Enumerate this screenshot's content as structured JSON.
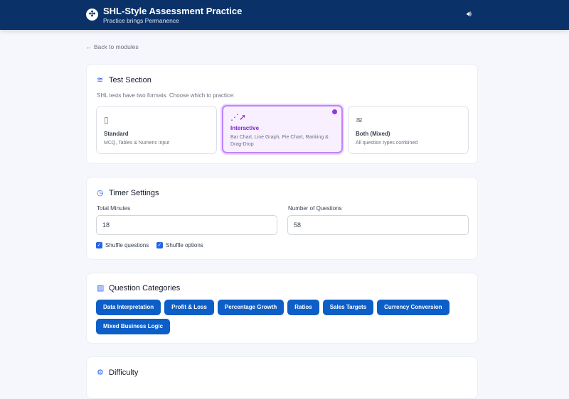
{
  "header": {
    "title": "SHL-Style Assessment Practice",
    "subtitle": "Practice brings Permanence"
  },
  "back_link": "Back to modules",
  "test_section": {
    "title": "Test Section",
    "description": "SHL tests have two formats. Choose which to practice:",
    "options": [
      {
        "name": "Standard",
        "desc": "MCQ, Tables & Numeric input"
      },
      {
        "name": "Interactive",
        "desc": "Bar Chart, Line Graph, Pie Chart, Ranking & Drag-Drop",
        "selected": true
      },
      {
        "name": "Both (Mixed)",
        "desc": "All question types combined"
      }
    ]
  },
  "timer": {
    "title": "Timer Settings",
    "total_minutes_label": "Total Minutes",
    "total_minutes": "18",
    "num_questions_label": "Number of Questions",
    "num_questions": "58",
    "shuffle_questions": "Shuffle questions",
    "shuffle_options": "Shuffle options"
  },
  "categories": {
    "title": "Question Categories",
    "items": [
      "Data Interpretation",
      "Profit & Loss",
      "Percentage Growth",
      "Ratios",
      "Sales Targets",
      "Currency Conversion",
      "Mixed Business Logic"
    ]
  },
  "difficulty": {
    "title": "Difficulty"
  },
  "colors": {
    "header": "#0b3268",
    "accent": "#0d5fc7",
    "selected": "#9333ea"
  }
}
